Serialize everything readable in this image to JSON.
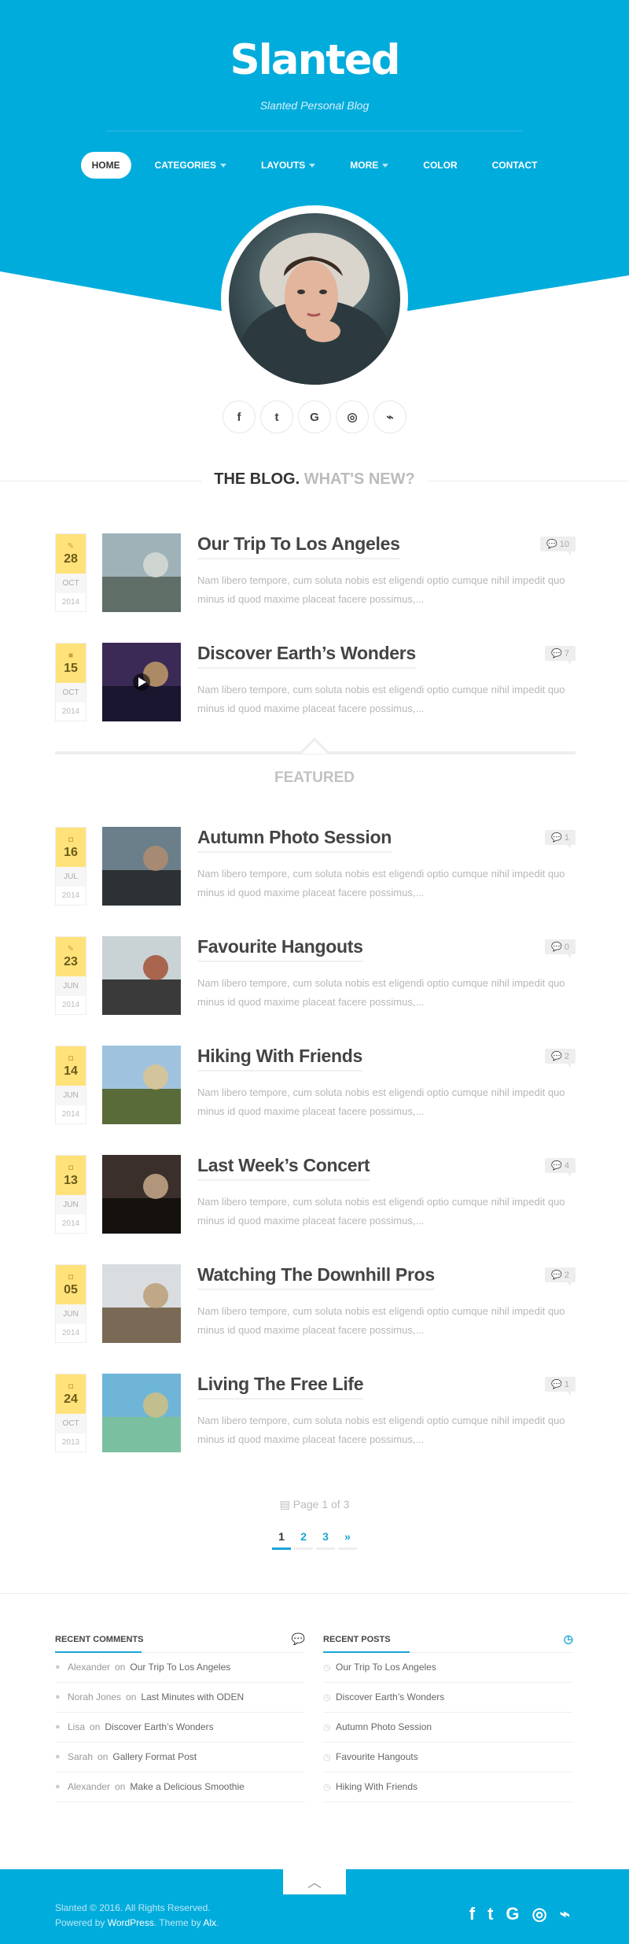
{
  "site": {
    "title": "Slanted",
    "tagline": "Slanted Personal Blog",
    "accent": "#00acdc"
  },
  "nav": {
    "items": [
      {
        "label": "Home",
        "active": true,
        "dropdown": false
      },
      {
        "label": "Categories",
        "active": false,
        "dropdown": true
      },
      {
        "label": "Layouts",
        "active": false,
        "dropdown": true
      },
      {
        "label": "More",
        "active": false,
        "dropdown": true
      },
      {
        "label": "Color",
        "active": false,
        "dropdown": false
      },
      {
        "label": "Contact",
        "active": false,
        "dropdown": false
      }
    ]
  },
  "social": {
    "icons": [
      "facebook-icon",
      "twitter-icon",
      "google-icon",
      "dribbble-icon",
      "rss-icon"
    ],
    "glyphs": [
      "f",
      "t",
      "G",
      "◎",
      "⌁"
    ]
  },
  "blog_heading": {
    "part1": "The blog.",
    "part2": "What's new?"
  },
  "featured_label": "Featured",
  "excerpt": "Nam libero tempore, cum soluta nobis est eligendi optio cumque nihil impedit quo minus id quod maxime placeat facere possimus,...",
  "posts": [
    {
      "title": "Our Trip To Los Angeles",
      "day": "28",
      "month": "Oct",
      "year": "2014",
      "comments": "10",
      "format_icon": "pencil-icon",
      "glyph": "✎"
    },
    {
      "title": "Discover Earth’s Wonders",
      "day": "15",
      "month": "Oct",
      "year": "2014",
      "comments": "7",
      "format_icon": "video-icon",
      "glyph": "■"
    },
    {
      "title": "Autumn Photo Session",
      "day": "16",
      "month": "Jul",
      "year": "2014",
      "comments": "1",
      "format_icon": "camera-icon",
      "glyph": "◘"
    },
    {
      "title": "Favourite Hangouts",
      "day": "23",
      "month": "Jun",
      "year": "2014",
      "comments": "0",
      "format_icon": "pencil-icon",
      "glyph": "✎"
    },
    {
      "title": "Hiking With Friends",
      "day": "14",
      "month": "Jun",
      "year": "2014",
      "comments": "2",
      "format_icon": "camera-icon",
      "glyph": "◘"
    },
    {
      "title": "Last Week’s Concert",
      "day": "13",
      "month": "Jun",
      "year": "2014",
      "comments": "4",
      "format_icon": "camera-icon",
      "glyph": "◘"
    },
    {
      "title": "Watching The Downhill Pros",
      "day": "05",
      "month": "Jun",
      "year": "2014",
      "comments": "2",
      "format_icon": "camera-icon",
      "glyph": "◘"
    },
    {
      "title": "Living The Free Life",
      "day": "24",
      "month": "Oct",
      "year": "2013",
      "comments": "1",
      "format_icon": "camera-icon",
      "glyph": "◘"
    }
  ],
  "pagination": {
    "summary": "Page 1 of 3",
    "pages": [
      "1",
      "2",
      "3",
      "»"
    ]
  },
  "recent_comments": {
    "title": "Recent Comments",
    "items": [
      {
        "author": "Alexander",
        "on": "on",
        "post": "Our Trip To Los Angeles"
      },
      {
        "author": "Norah Jones",
        "on": "on",
        "post": "Last Minutes with ODEN"
      },
      {
        "author": "Lisa",
        "on": "on",
        "post": "Discover Earth’s Wonders"
      },
      {
        "author": "Sarah",
        "on": "on",
        "post": "Gallery Format Post"
      },
      {
        "author": "Alexander",
        "on": "on",
        "post": "Make a Delicious Smoothie"
      }
    ]
  },
  "recent_posts": {
    "title": "Recent Posts",
    "items": [
      "Our Trip To Los Angeles",
      "Discover Earth’s Wonders",
      "Autumn Photo Session",
      "Favourite Hangouts",
      "Hiking With Friends"
    ]
  },
  "footer": {
    "copyright": "Slanted © 2016. All Rights Reserved.",
    "powered_prefix": "Powered by",
    "powered_link": "WordPress",
    "theme_prefix": ". Theme by",
    "theme_link": "Alx",
    "theme_suffix": ".",
    "social_glyphs": [
      "f",
      "t",
      "G",
      "◎",
      "⌁"
    ]
  }
}
